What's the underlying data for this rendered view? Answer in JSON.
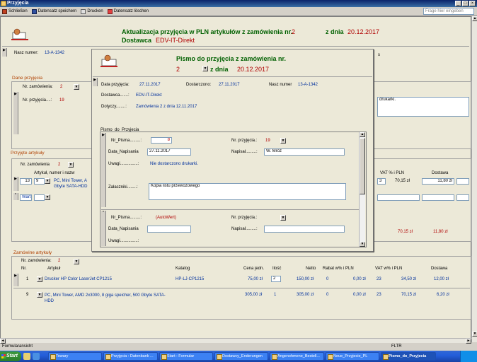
{
  "window": {
    "title": "Przyjęcia"
  },
  "toolbar": {
    "close": "Schließen",
    "save": "Datensatz speichern",
    "print": "Drucken",
    "delete": "Datensatz löschen",
    "help_placeholder": "Frage hier eingeben"
  },
  "header": {
    "title": "Aktualizacja przyjęcia w PLN artykułów z zamówienia nr.",
    "order_no": "2",
    "date_label": "z dnia",
    "date": "20.12.2017",
    "supplier_label": "Dostawca",
    "supplier": "EDV-IT-Direkt"
  },
  "main": {
    "nasz_numer_label": "Nasz numer:",
    "nasz_numer": "13-A-1342",
    "dane_przyjecia": "Dane przyjęcia",
    "nr_zamowienia_label": "Nr. zamówienia:",
    "nr_zamowienia": "2",
    "nr_przyjecia_label": "Nr. przyjęcia....:",
    "nr_przyjecia": "19",
    "note_partial": "drukarki.",
    "s_partial": "s",
    "przyjete_artykuly": "Przyjęte artykuły",
    "pa_nr_zam_label": "Nr. zamówienia",
    "pa_nr_zam": "2",
    "pa_col_artykul": "Artykuł, numer i nazw",
    "pa_col_vat": "VAT % i PLN",
    "pa_col_dostawa": "Dostawa",
    "pa_row_qty": "13",
    "pa_row_pos": "9",
    "pa_row_text": "PC, Mini Tower, A Gbyte SATA-HDD",
    "pa_row_vat_rate": "3",
    "pa_row_vat": "70,15 zł",
    "pa_row_dostawa": "11,80 zł",
    "pa_new": "Wart)",
    "pa_sum_vat": "70,15 zł",
    "pa_sum_dostawa": "11,80 zł"
  },
  "zamowione": {
    "title": "Zamówine artykuły",
    "nr_zam_label": "Nr. zamówienia:",
    "nr_zam": "2",
    "columns": [
      "Nr.",
      "Artykuł",
      "Katalog",
      "Cena jedn.",
      "Ilość",
      "Netto",
      "Rabat w% i PLN",
      "VAT w% i PLN",
      "Dostawa"
    ],
    "rows": [
      {
        "nr": "1",
        "artykul": "Drucker HP Color LaserJet CP1215",
        "katalog": "HP-LJ-CP1215",
        "cena": "75,00 zł",
        "ilosc": "2",
        "netto": "150,00 zł",
        "rabat_pct": "0",
        "rabat": "0,00 zł",
        "vat_pct": "23",
        "vat": "34,50 zł",
        "dostawa": "12,00 zł"
      },
      {
        "nr": "9",
        "artykul": "PC, Mini Tower, AMD 2x3000, 8 giga speicher, 500 Gbyte SATA-HDD",
        "katalog": "",
        "cena": "305,00 zł",
        "ilosc": "1",
        "netto": "305,00 zł",
        "rabat_pct": "0",
        "rabat": "0,00 zł",
        "vat_pct": "23",
        "vat": "70,15 zł",
        "dostawa": "6,20 zł"
      }
    ]
  },
  "popup": {
    "title": "Pismo do przyjęcia z zamówienia nr.",
    "order_no": "2",
    "date_label": "z dnia",
    "date": "20.12.2017",
    "data_przyjecia_label": "Data przyjęcia:",
    "data_przyjecia": "27.11.2017",
    "dostarczono_label": "Dostarczono:",
    "dostarczono": "27.11.2017",
    "nasz_numer_label": "Nasz numer",
    "nasz_numer": "13-A-1342",
    "dostawca_label": "Dostawca.......:",
    "dostawca": "EDV-IT-Direkt",
    "dotyczy_label": "Dotyczy........:",
    "dotyczy": "Zamówienia 2 z dnia 12.11.2017",
    "subform_label": "Pismo_do_Przyjecia_",
    "rec1": {
      "nr_pisma_label": "Nr_Pisma.........:",
      "nr_pisma": "8",
      "nr_przyjecia_label": "Nr. przyjęcia.:",
      "nr_przyjecia": "19",
      "data_label": "Data_Napisania",
      "data": "27.11.2017",
      "napisal_label": "Napisał.........:",
      "napisal": "W. Mróz",
      "uwagi_label": "Uwagi...............:",
      "uwagi": "Nie dostarczono drukarki.",
      "zalaczniki_label": "Załaczniki........:",
      "zalaczniki": "Kopia listu przewozowego"
    },
    "rec2": {
      "nr_pisma_label": "Nr_Pisma.........:",
      "nr_pisma": "(AutoWert)",
      "nr_przyjecia_label": "Nr. przyjęcia.:",
      "data_label": "Data_Napisania",
      "napisal_label": "Napisał.........:",
      "uwagi_label": "Uwagi...............:"
    }
  },
  "statusbar": {
    "left": "Formularansicht",
    "right": "FLTR"
  },
  "taskbar": {
    "start": "Start",
    "tasks": [
      "Towary",
      "Przyjęcia : Datenbank ...",
      "Start : Formular",
      "Dostawcy_Enderungen",
      "Angenohmene_Bestell...",
      "Neue_Przyjecie_PL",
      "Pismo_do_Przyjecia"
    ]
  }
}
